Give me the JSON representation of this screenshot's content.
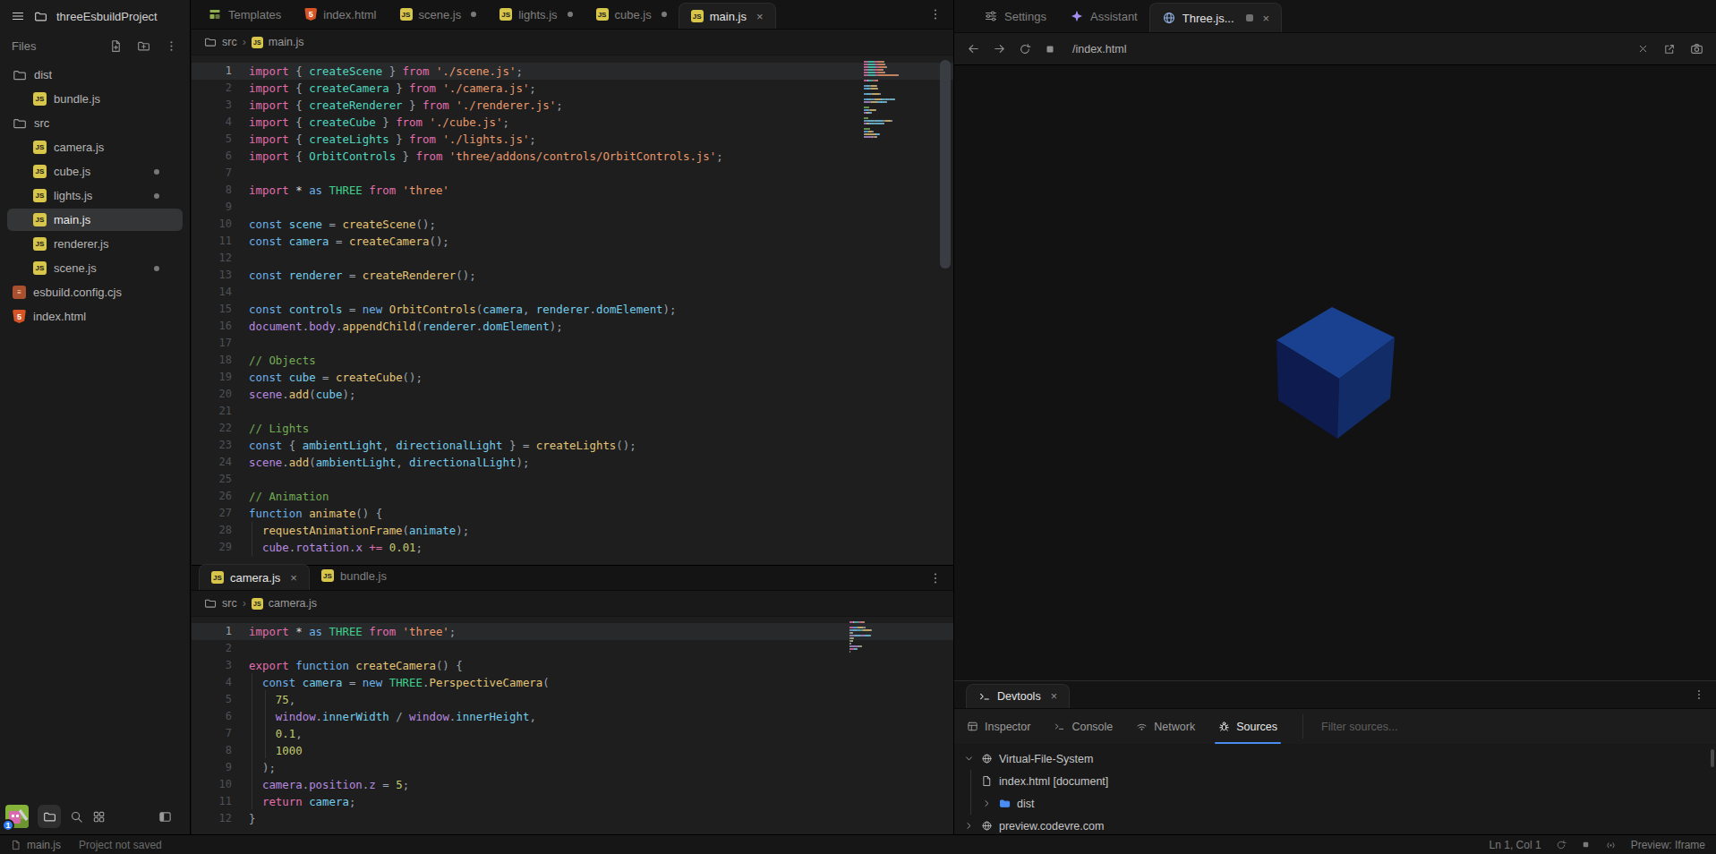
{
  "sidebar": {
    "title": "threeEsbuildProject",
    "files_label": "Files",
    "tree": [
      {
        "name": "dist",
        "type": "folder",
        "indent": 0
      },
      {
        "name": "bundle.js",
        "type": "js",
        "indent": 1
      },
      {
        "name": "src",
        "type": "folder",
        "indent": 0
      },
      {
        "name": "camera.js",
        "type": "js",
        "indent": 1
      },
      {
        "name": "cube.js",
        "type": "js",
        "indent": 1,
        "dot": true
      },
      {
        "name": "lights.js",
        "type": "js",
        "indent": 1,
        "dot": true
      },
      {
        "name": "main.js",
        "type": "js",
        "indent": 1,
        "selected": true
      },
      {
        "name": "renderer.js",
        "type": "js",
        "indent": 1
      },
      {
        "name": "scene.js",
        "type": "js",
        "indent": 1,
        "dot": true
      },
      {
        "name": "esbuild.config.cjs",
        "type": "config",
        "indent": 0
      },
      {
        "name": "index.html",
        "type": "html",
        "indent": 0
      }
    ],
    "badge_count": "1"
  },
  "editor": {
    "tabs": [
      {
        "label": "Templates",
        "icon": "templates"
      },
      {
        "label": "index.html",
        "icon": "html"
      },
      {
        "label": "scene.js",
        "icon": "js",
        "dot": true
      },
      {
        "label": "lights.js",
        "icon": "js",
        "dot": true
      },
      {
        "label": "cube.js",
        "icon": "js",
        "dot": true
      },
      {
        "label": "main.js",
        "icon": "js",
        "active": true,
        "close": true
      }
    ],
    "breadcrumb": {
      "folder": "src",
      "file": "main.js"
    },
    "lines": [
      [
        [
          "k",
          "import "
        ],
        [
          "p",
          "{ "
        ],
        [
          "t",
          "createScene"
        ],
        [
          "p",
          " } "
        ],
        [
          "k",
          "from "
        ],
        [
          "s",
          "'./scene.js'"
        ],
        [
          "p",
          ";"
        ]
      ],
      [
        [
          "k",
          "import "
        ],
        [
          "p",
          "{ "
        ],
        [
          "t",
          "createCamera"
        ],
        [
          "p",
          " } "
        ],
        [
          "k",
          "from "
        ],
        [
          "s",
          "'./camera.js'"
        ],
        [
          "p",
          ";"
        ]
      ],
      [
        [
          "k",
          "import "
        ],
        [
          "p",
          "{ "
        ],
        [
          "t",
          "createRenderer"
        ],
        [
          "p",
          " } "
        ],
        [
          "k",
          "from "
        ],
        [
          "s",
          "'./renderer.js'"
        ],
        [
          "p",
          ";"
        ]
      ],
      [
        [
          "k",
          "import "
        ],
        [
          "p",
          "{ "
        ],
        [
          "t",
          "createCube"
        ],
        [
          "p",
          " } "
        ],
        [
          "k",
          "from "
        ],
        [
          "s",
          "'./cube.js'"
        ],
        [
          "p",
          ";"
        ]
      ],
      [
        [
          "k",
          "import "
        ],
        [
          "p",
          "{ "
        ],
        [
          "t",
          "createLights"
        ],
        [
          "p",
          " } "
        ],
        [
          "k",
          "from "
        ],
        [
          "s",
          "'./lights.js'"
        ],
        [
          "p",
          ";"
        ]
      ],
      [
        [
          "k",
          "import "
        ],
        [
          "p",
          "{ "
        ],
        [
          "t",
          "OrbitControls"
        ],
        [
          "p",
          " } "
        ],
        [
          "k",
          "from "
        ],
        [
          "s",
          "'three/addons/controls/OrbitControls.js'"
        ],
        [
          "p",
          ";"
        ]
      ],
      [],
      [
        [
          "k",
          "import "
        ],
        [
          "w",
          "* "
        ],
        [
          "c",
          "as "
        ],
        [
          "g",
          "THREE "
        ],
        [
          "k",
          "from "
        ],
        [
          "s",
          "'three'"
        ]
      ],
      [],
      [
        [
          "c",
          "const "
        ],
        [
          "v",
          "scene"
        ],
        [
          "p",
          " = "
        ],
        [
          "f",
          "createScene"
        ],
        [
          "p",
          "();"
        ]
      ],
      [
        [
          "c",
          "const "
        ],
        [
          "v",
          "camera"
        ],
        [
          "p",
          " = "
        ],
        [
          "f",
          "createCamera"
        ],
        [
          "p",
          "();"
        ]
      ],
      [],
      [
        [
          "c",
          "const "
        ],
        [
          "v",
          "renderer"
        ],
        [
          "p",
          " = "
        ],
        [
          "f",
          "createRenderer"
        ],
        [
          "p",
          "();"
        ]
      ],
      [],
      [
        [
          "c",
          "const "
        ],
        [
          "v",
          "controls"
        ],
        [
          "p",
          " = "
        ],
        [
          "c",
          "new "
        ],
        [
          "f",
          "OrbitControls"
        ],
        [
          "p",
          "("
        ],
        [
          "v",
          "camera"
        ],
        [
          "p",
          ", "
        ],
        [
          "v",
          "renderer"
        ],
        [
          "p",
          "."
        ],
        [
          "v",
          "domElement"
        ],
        [
          "p",
          ");"
        ]
      ],
      [
        [
          "r",
          "document"
        ],
        [
          "p",
          "."
        ],
        [
          "r",
          "body"
        ],
        [
          "p",
          "."
        ],
        [
          "f",
          "appendChild"
        ],
        [
          "p",
          "("
        ],
        [
          "v",
          "renderer"
        ],
        [
          "p",
          "."
        ],
        [
          "v",
          "domElement"
        ],
        [
          "p",
          ");"
        ]
      ],
      [],
      [
        [
          "m",
          "// Objects"
        ]
      ],
      [
        [
          "c",
          "const "
        ],
        [
          "v",
          "cube"
        ],
        [
          "p",
          " = "
        ],
        [
          "f",
          "createCube"
        ],
        [
          "p",
          "();"
        ]
      ],
      [
        [
          "r",
          "scene"
        ],
        [
          "p",
          "."
        ],
        [
          "f",
          "add"
        ],
        [
          "p",
          "("
        ],
        [
          "v",
          "cube"
        ],
        [
          "p",
          ");"
        ]
      ],
      [],
      [
        [
          "m",
          "// Lights"
        ]
      ],
      [
        [
          "c",
          "const "
        ],
        [
          "p",
          "{ "
        ],
        [
          "v",
          "ambientLight"
        ],
        [
          "p",
          ", "
        ],
        [
          "v",
          "directionalLight"
        ],
        [
          "p",
          " } = "
        ],
        [
          "f",
          "createLights"
        ],
        [
          "p",
          "();"
        ]
      ],
      [
        [
          "r",
          "scene"
        ],
        [
          "p",
          "."
        ],
        [
          "f",
          "add"
        ],
        [
          "p",
          "("
        ],
        [
          "v",
          "ambientLight"
        ],
        [
          "p",
          ", "
        ],
        [
          "v",
          "directionalLight"
        ],
        [
          "p",
          ");"
        ]
      ],
      [],
      [
        [
          "m",
          "// Animation"
        ]
      ],
      [
        [
          "c",
          "function "
        ],
        [
          "f",
          "animate"
        ],
        [
          "p",
          "() {"
        ]
      ],
      [
        [
          "p",
          "  "
        ],
        [
          "f",
          "requestAnimationFrame"
        ],
        [
          "p",
          "("
        ],
        [
          "v",
          "animate"
        ],
        [
          "p",
          ");"
        ]
      ],
      [
        [
          "p",
          "  "
        ],
        [
          "r",
          "cube"
        ],
        [
          "p",
          "."
        ],
        [
          "r",
          "rotation"
        ],
        [
          "p",
          "."
        ],
        [
          "r",
          "x"
        ],
        [
          "p",
          " "
        ],
        [
          "k",
          "+= "
        ],
        [
          "n",
          "0.01"
        ],
        [
          "p",
          ";"
        ]
      ]
    ]
  },
  "bottom_pane": {
    "tabs": [
      {
        "label": "camera.js",
        "icon": "js",
        "active": true,
        "close": true
      },
      {
        "label": "bundle.js",
        "icon": "js"
      }
    ],
    "breadcrumb": {
      "folder": "src",
      "file": "camera.js"
    },
    "lines": [
      [
        [
          "k",
          "import "
        ],
        [
          "w",
          "* "
        ],
        [
          "c",
          "as "
        ],
        [
          "g",
          "THREE "
        ],
        [
          "k",
          "from "
        ],
        [
          "s",
          "'three'"
        ],
        [
          "p",
          ";"
        ]
      ],
      [],
      [
        [
          "k",
          "export "
        ],
        [
          "c",
          "function "
        ],
        [
          "f",
          "createCamera"
        ],
        [
          "p",
          "() {"
        ]
      ],
      [
        [
          "p",
          "  "
        ],
        [
          "c",
          "const "
        ],
        [
          "v",
          "camera"
        ],
        [
          "p",
          " = "
        ],
        [
          "c",
          "new "
        ],
        [
          "g",
          "THREE"
        ],
        [
          "p",
          "."
        ],
        [
          "f",
          "PerspectiveCamera"
        ],
        [
          "p",
          "("
        ]
      ],
      [
        [
          "p",
          "    "
        ],
        [
          "n",
          "75"
        ],
        [
          "p",
          ","
        ]
      ],
      [
        [
          "p",
          "    "
        ],
        [
          "r",
          "window"
        ],
        [
          "p",
          "."
        ],
        [
          "v",
          "innerWidth"
        ],
        [
          "p",
          " / "
        ],
        [
          "r",
          "window"
        ],
        [
          "p",
          "."
        ],
        [
          "v",
          "innerHeight"
        ],
        [
          "p",
          ","
        ]
      ],
      [
        [
          "p",
          "    "
        ],
        [
          "n",
          "0.1"
        ],
        [
          "p",
          ","
        ]
      ],
      [
        [
          "p",
          "    "
        ],
        [
          "n",
          "1000"
        ]
      ],
      [
        [
          "p",
          "  );"
        ]
      ],
      [
        [
          "p",
          "  "
        ],
        [
          "r",
          "camera"
        ],
        [
          "p",
          "."
        ],
        [
          "r",
          "position"
        ],
        [
          "p",
          "."
        ],
        [
          "r",
          "z"
        ],
        [
          "p",
          " = "
        ],
        [
          "n",
          "5"
        ],
        [
          "p",
          ";"
        ]
      ],
      [
        [
          "p",
          "  "
        ],
        [
          "k",
          "return "
        ],
        [
          "v",
          "camera"
        ],
        [
          "p",
          ";"
        ]
      ],
      [
        [
          "p",
          "}"
        ]
      ]
    ]
  },
  "preview": {
    "tabs": [
      {
        "label": "Settings",
        "icon": "settings"
      },
      {
        "label": "Assistant",
        "icon": "assistant"
      },
      {
        "label": "Three.js...",
        "icon": "globe",
        "active": true,
        "square": true,
        "close": true
      }
    ],
    "url": "/index.html",
    "cube": {
      "top": "#1a418f",
      "left": "#0d1b4e",
      "right": "#122c68"
    }
  },
  "devtools": {
    "tab_label": "Devtools",
    "toolbar": [
      {
        "label": "Inspector",
        "icon": "inspector"
      },
      {
        "label": "Console",
        "icon": "terminal"
      },
      {
        "label": "Network",
        "icon": "wifi"
      },
      {
        "label": "Sources",
        "icon": "bug",
        "active": true
      }
    ],
    "filter_placeholder": "Filter sources...",
    "tree": [
      {
        "label": "Virtual-File-System",
        "icon": "globe",
        "chevron": "down",
        "indent": 0
      },
      {
        "label": "index.html [document]",
        "icon": "file",
        "indent": 1
      },
      {
        "label": "dist",
        "icon": "folder-blue",
        "chevron": "right",
        "indent": 1
      },
      {
        "label": "preview.codevre.com",
        "icon": "globe",
        "chevron": "right",
        "indent": 0
      }
    ]
  },
  "statusbar": {
    "left_file": "main.js",
    "left_status": "Project not saved",
    "position": "Ln 1, Col 1",
    "preview_mode": "Preview: Iframe"
  }
}
